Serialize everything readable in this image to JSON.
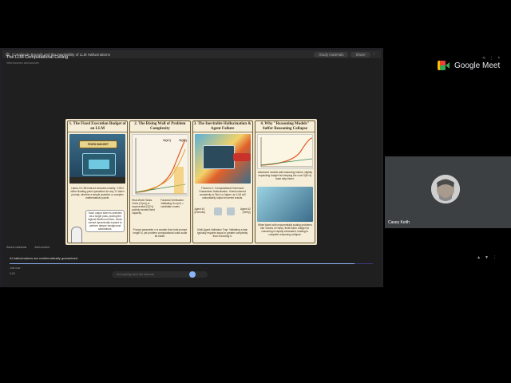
{
  "meet": {
    "brand": "Google Meet"
  },
  "browser": {
    "tab_title": "Complexity Bounds and the Inevitability of LLM Hallucinations",
    "action_1": "Study materials",
    "action_2": "Share"
  },
  "notebook": {
    "title": "The LLM Computational Ceiling",
    "subtitle": "View sources and sources"
  },
  "slide": {
    "panels": [
      {
        "title": "1. The Fixed Execution Budget of an LLM",
        "badge": "FIXED BUDGET",
        "text": "Llama-3.2-3B-Instruct executes exactly ~109.2 billion floating-point operations for any 17-token prompt, whether a simple question or complex mathematical puzzle.",
        "text2": "Each output token is selected via a single pass, picking the highest likelihood token, which cannot dynamically expand to perform deeper background calculations."
      },
      {
        "title": "2. The Rising Wall of Problem Complexity",
        "formula": "O(n³)",
        "formula2": "O(2ⁿ)",
        "text": "Real-World Tasks: Cubic (O(n³)) or exponential (O(2ⁿ)) quickly exceed fixed capacity.",
        "text2": "Factorial Verification: Validating 2n-n(n!) = candidate routes.",
        "text3": "Prompt parameter n is smaller than total prompt length N, yet problem computational costs scale far faster."
      },
      {
        "title": "3. The Inevitable Hallucination & Agent Failure",
        "text": "Theorem 1: Computational Overreach Guarantees Hallucination. If task-inherent complexity is O(n³) or higher, an LLM will unavoidably output incorrect results.",
        "agent1": "Agent #1 (Execute)",
        "agent2": "Agent #2 (Verify)",
        "text2": "Multi-Agent Validation Trap: Validating a task typically requires equal or greater complexity than executing it."
      },
      {
        "title": "4. Why \"Reasoning Models\" Suffer Reasoning Collapse",
        "text": "Advanced models add reasoning tokens, slightly expanding budget but keeping the core O(N²·d) base step intact.",
        "text2": "When faced with exponentially scaling problems like Towers of Hanoi, finite token budget for reasoning is rapidly exhausted, leading to complete reasoning collapse."
      }
    ]
  },
  "caption": {
    "left": "Saved notebook",
    "right": "Add content"
  },
  "question": "AI hallucinations are mathematically guaranteed",
  "progress": {
    "fraction": 0.95
  },
  "meta": {
    "line1": "Just now",
    "line2": "0:00"
  },
  "prompt": {
    "placeholder": "Ask anything about this notebook"
  },
  "participant": {
    "name": "Casey Keith"
  },
  "colors": {
    "meet_bg": "#000000",
    "tile": "#3c4043",
    "accent": "#8ab4f8"
  }
}
